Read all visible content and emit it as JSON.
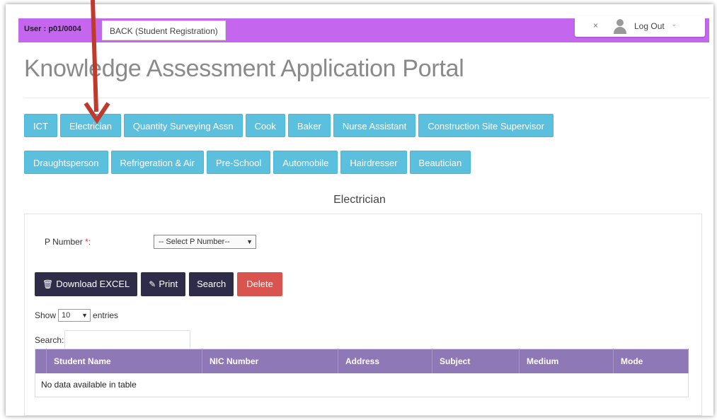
{
  "topbar": {
    "user": "User : p01/0004",
    "back_tab": "BACK (Student Registration)",
    "close": "×",
    "logout": "Log Out",
    "caret": "⌄"
  },
  "page_title": "Knowledge Assessment Application Portal",
  "categories_row1": [
    "ICT",
    "Electrician",
    "Quantity Surveying Assn",
    "Cook",
    "Baker",
    "Nurse Assistant",
    "Construction Site Supervisor"
  ],
  "categories_row2": [
    "Draughtsperson",
    "Refrigeration & Air",
    "Pre-School",
    "Automobile",
    "Hairdresser",
    "Beautician"
  ],
  "section_title": "Electrician",
  "form": {
    "p_number_label": "P Number",
    "required_mark": "*:",
    "p_number_select": "-- Select P Number--",
    "select_caret": "▼"
  },
  "actions": {
    "download": "Download EXCEL",
    "print": "Print",
    "search": "Search",
    "delete": "Delete"
  },
  "table_controls": {
    "show": "Show",
    "entries_value": "10",
    "entries": "entries",
    "search_label": "Search:"
  },
  "table": {
    "columns": [
      "Student Name",
      "NIC Number",
      "Address",
      "Subject",
      "Medium",
      "Mode"
    ],
    "empty_message": "No data available in table"
  },
  "colors": {
    "topbar": "#c466ee",
    "category_button": "#5bc0de",
    "dark_button": "#2e2c48",
    "delete_button": "#d9534f",
    "table_header": "#8e79b6",
    "annotation_arrow": "#c0392b"
  }
}
